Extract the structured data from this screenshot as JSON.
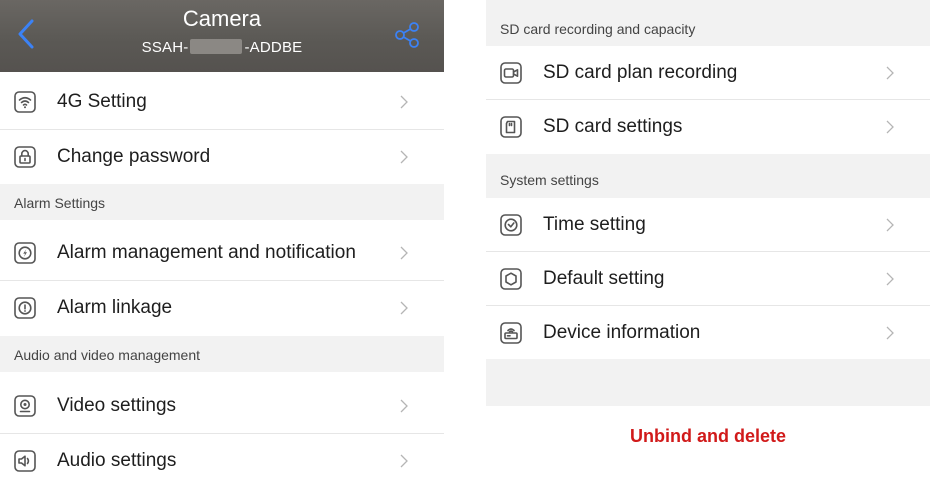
{
  "header": {
    "title": "Camera",
    "device_id_prefix": "SSAH-",
    "device_id_suffix": "-ADDBE"
  },
  "left": {
    "rows_top": [
      {
        "label": "4G Setting",
        "icon": "wifi-signal-icon"
      },
      {
        "label": "Change password",
        "icon": "lock-icon"
      }
    ],
    "section_alarm": "Alarm Settings",
    "alarm_rows": [
      {
        "label": "Alarm management and notification",
        "icon": "alarm-gauge-icon"
      },
      {
        "label": "Alarm linkage",
        "icon": "alarm-linkage-icon"
      }
    ],
    "section_av": "Audio and video management",
    "av_rows": [
      {
        "label": "Video settings",
        "icon": "webcam-icon"
      },
      {
        "label": "Audio settings",
        "icon": "speaker-icon"
      }
    ]
  },
  "right": {
    "section_sd": "SD card recording and capacity",
    "sd_rows": [
      {
        "label": "SD card plan recording",
        "icon": "video-record-icon"
      },
      {
        "label": "SD card settings",
        "icon": "sd-card-icon"
      }
    ],
    "section_system": "System settings",
    "system_rows": [
      {
        "label": "Time setting",
        "icon": "clock-icon"
      },
      {
        "label": "Default setting",
        "icon": "reset-icon"
      },
      {
        "label": "Device information",
        "icon": "router-icon"
      }
    ],
    "unbind_label": "Unbind and delete"
  },
  "colors": {
    "header_bg": "#5b5955",
    "back_blue": "#3b82f6",
    "danger": "#d11a1a",
    "section_bg": "#f2f2f2"
  }
}
